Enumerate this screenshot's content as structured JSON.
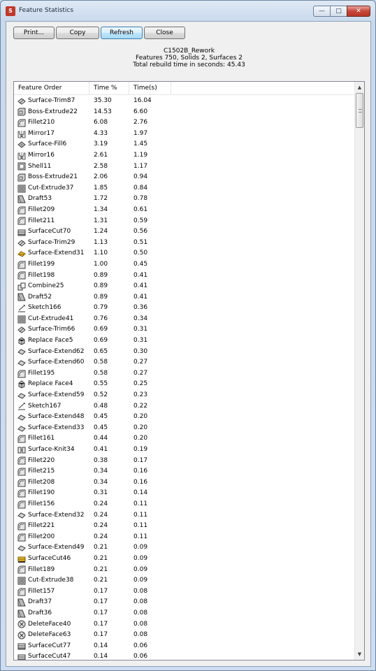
{
  "window": {
    "title": "Feature Statistics"
  },
  "toolbar": {
    "print": "Print...",
    "copy": "Copy",
    "refresh": "Refresh",
    "close": "Close"
  },
  "summary": {
    "part": "C1502B_Rework",
    "counts": "Features 750, Solids 2, Surfaces 2",
    "rebuild": "Total rebuild time in seconds: 45.43"
  },
  "columns": {
    "order": "Feature Order",
    "pct": "Time %",
    "time": "Time(s)"
  },
  "rows": [
    {
      "name": "Surface-Trim87",
      "pct": "35.30",
      "time": "16.04",
      "icon": "surface-trim"
    },
    {
      "name": "Boss-Extrude22",
      "pct": "14.53",
      "time": "6.60",
      "icon": "extrude"
    },
    {
      "name": "Fillet210",
      "pct": "6.08",
      "time": "2.76",
      "icon": "fillet"
    },
    {
      "name": "Mirror17",
      "pct": "4.33",
      "time": "1.97",
      "icon": "mirror"
    },
    {
      "name": "Surface-Fill6",
      "pct": "3.19",
      "time": "1.45",
      "icon": "surface-fill"
    },
    {
      "name": "Mirror16",
      "pct": "2.61",
      "time": "1.19",
      "icon": "mirror"
    },
    {
      "name": "Shell11",
      "pct": "2.58",
      "time": "1.17",
      "icon": "shell"
    },
    {
      "name": "Boss-Extrude21",
      "pct": "2.06",
      "time": "0.94",
      "icon": "extrude"
    },
    {
      "name": "Cut-Extrude37",
      "pct": "1.85",
      "time": "0.84",
      "icon": "cut"
    },
    {
      "name": "Draft53",
      "pct": "1.72",
      "time": "0.78",
      "icon": "draft"
    },
    {
      "name": "Fillet209",
      "pct": "1.34",
      "time": "0.61",
      "icon": "fillet"
    },
    {
      "name": "Fillet211",
      "pct": "1.31",
      "time": "0.59",
      "icon": "fillet"
    },
    {
      "name": "SurfaceCut70",
      "pct": "1.24",
      "time": "0.56",
      "icon": "surface-cut"
    },
    {
      "name": "Surface-Trim29",
      "pct": "1.13",
      "time": "0.51",
      "icon": "surface-trim"
    },
    {
      "name": "Surface-Extend31",
      "pct": "1.10",
      "time": "0.50",
      "icon": "surface-extend-warn"
    },
    {
      "name": "Fillet199",
      "pct": "1.00",
      "time": "0.45",
      "icon": "fillet"
    },
    {
      "name": "Fillet198",
      "pct": "0.89",
      "time": "0.41",
      "icon": "fillet"
    },
    {
      "name": "Combine25",
      "pct": "0.89",
      "time": "0.41",
      "icon": "combine"
    },
    {
      "name": "Draft52",
      "pct": "0.89",
      "time": "0.41",
      "icon": "draft"
    },
    {
      "name": "Sketch166",
      "pct": "0.79",
      "time": "0.36",
      "icon": "sketch"
    },
    {
      "name": "Cut-Extrude41",
      "pct": "0.76",
      "time": "0.34",
      "icon": "cut"
    },
    {
      "name": "Surface-Trim66",
      "pct": "0.69",
      "time": "0.31",
      "icon": "surface-trim"
    },
    {
      "name": "Replace Face5",
      "pct": "0.69",
      "time": "0.31",
      "icon": "replace-face"
    },
    {
      "name": "Surface-Extend62",
      "pct": "0.65",
      "time": "0.30",
      "icon": "surface-extend"
    },
    {
      "name": "Surface-Extend60",
      "pct": "0.58",
      "time": "0.27",
      "icon": "surface-extend"
    },
    {
      "name": "Fillet195",
      "pct": "0.58",
      "time": "0.27",
      "icon": "fillet"
    },
    {
      "name": "Replace Face4",
      "pct": "0.55",
      "time": "0.25",
      "icon": "replace-face"
    },
    {
      "name": "Surface-Extend59",
      "pct": "0.52",
      "time": "0.23",
      "icon": "surface-extend"
    },
    {
      "name": "Sketch167",
      "pct": "0.48",
      "time": "0.22",
      "icon": "sketch"
    },
    {
      "name": "Surface-Extend48",
      "pct": "0.45",
      "time": "0.20",
      "icon": "surface-extend"
    },
    {
      "name": "Surface-Extend33",
      "pct": "0.45",
      "time": "0.20",
      "icon": "surface-extend"
    },
    {
      "name": "Fillet161",
      "pct": "0.44",
      "time": "0.20",
      "icon": "fillet"
    },
    {
      "name": "Surface-Knit34",
      "pct": "0.41",
      "time": "0.19",
      "icon": "knit"
    },
    {
      "name": "Fillet220",
      "pct": "0.38",
      "time": "0.17",
      "icon": "fillet"
    },
    {
      "name": "Fillet215",
      "pct": "0.34",
      "time": "0.16",
      "icon": "fillet"
    },
    {
      "name": "Fillet208",
      "pct": "0.34",
      "time": "0.16",
      "icon": "fillet"
    },
    {
      "name": "Fillet190",
      "pct": "0.31",
      "time": "0.14",
      "icon": "fillet"
    },
    {
      "name": "Fillet156",
      "pct": "0.24",
      "time": "0.11",
      "icon": "fillet"
    },
    {
      "name": "Surface-Extend32",
      "pct": "0.24",
      "time": "0.11",
      "icon": "surface-extend"
    },
    {
      "name": "Fillet221",
      "pct": "0.24",
      "time": "0.11",
      "icon": "fillet"
    },
    {
      "name": "Fillet200",
      "pct": "0.24",
      "time": "0.11",
      "icon": "fillet"
    },
    {
      "name": "Surface-Extend49",
      "pct": "0.21",
      "time": "0.09",
      "icon": "surface-extend"
    },
    {
      "name": "SurfaceCut46",
      "pct": "0.21",
      "time": "0.09",
      "icon": "surface-cut-warn"
    },
    {
      "name": "Fillet189",
      "pct": "0.21",
      "time": "0.09",
      "icon": "fillet"
    },
    {
      "name": "Cut-Extrude38",
      "pct": "0.21",
      "time": "0.09",
      "icon": "cut"
    },
    {
      "name": "Fillet157",
      "pct": "0.17",
      "time": "0.08",
      "icon": "fillet"
    },
    {
      "name": "Draft37",
      "pct": "0.17",
      "time": "0.08",
      "icon": "draft"
    },
    {
      "name": "Draft36",
      "pct": "0.17",
      "time": "0.08",
      "icon": "draft"
    },
    {
      "name": "DeleteFace40",
      "pct": "0.17",
      "time": "0.08",
      "icon": "delete-face"
    },
    {
      "name": "DeleteFace63",
      "pct": "0.17",
      "time": "0.08",
      "icon": "delete-face"
    },
    {
      "name": "SurfaceCut77",
      "pct": "0.14",
      "time": "0.06",
      "icon": "surface-cut"
    },
    {
      "name": "SurfaceCut47",
      "pct": "0.14",
      "time": "0.06",
      "icon": "surface-cut"
    }
  ]
}
